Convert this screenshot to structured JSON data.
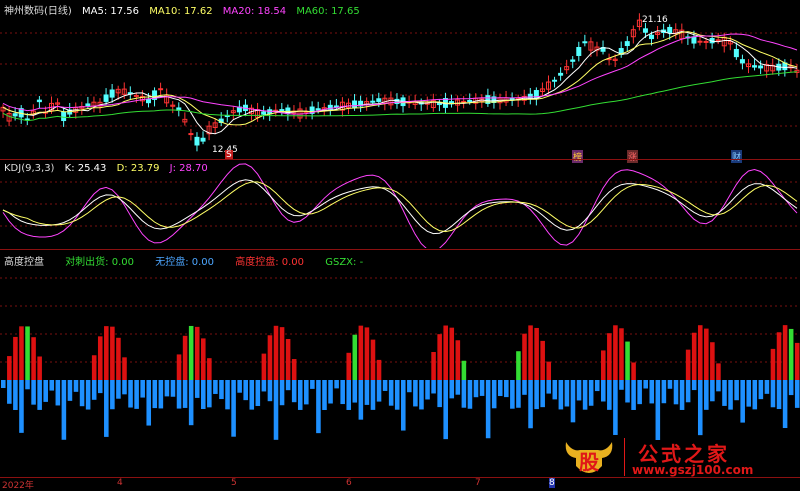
{
  "main": {
    "stock_title": "神州数码(日线)",
    "ma5": {
      "label": "MA5: 17.56",
      "color": "#ffffff"
    },
    "ma10": {
      "label": "MA10: 17.62",
      "color": "#ffff66"
    },
    "ma20": {
      "label": "MA20: 18.54",
      "color": "#ff44ff"
    },
    "ma60": {
      "label": "MA60: 17.65",
      "color": "#33dd33"
    },
    "high_label": "21.16",
    "low_label": "12.45",
    "badges": [
      "S",
      "榜",
      "涨",
      "财"
    ]
  },
  "kdj": {
    "title": "KDJ(9,3,3)",
    "k": {
      "label": "K: 25.43",
      "color": "#ffffff"
    },
    "d": {
      "label": "D: 23.79",
      "color": "#ffff66"
    },
    "j": {
      "label": "J: 28.70",
      "color": "#ff44ff"
    }
  },
  "control": {
    "title": "高度控盘",
    "out": {
      "label": "对刺出货: 0.00",
      "color": "#33dd33"
    },
    "none": {
      "label": "无控盘: 0.00",
      "color": "#4da6ff"
    },
    "high": {
      "label": "高度控盘: 0.00",
      "color": "#ff3333"
    },
    "gszx": {
      "label": "GSZX: -",
      "color": "#33dd33"
    }
  },
  "xaxis": {
    "labels": [
      "2022年",
      "4",
      "5",
      "6",
      "7",
      "8"
    ]
  },
  "watermark": {
    "title": "公式之家",
    "url": "www.gszj100.com",
    "logo_char": "股"
  },
  "chart_data": [
    {
      "type": "line",
      "title": "神州数码(日线)",
      "series": [
        {
          "name": "MA5",
          "value": 17.56
        },
        {
          "name": "MA10",
          "value": 17.62
        },
        {
          "name": "MA20",
          "value": 18.54
        },
        {
          "name": "MA60",
          "value": 17.65
        }
      ],
      "annotations": [
        "21.16",
        "12.45"
      ]
    },
    {
      "type": "line",
      "title": "KDJ(9,3,3)",
      "series": [
        {
          "name": "K",
          "value": 25.43
        },
        {
          "name": "D",
          "value": 23.79
        },
        {
          "name": "J",
          "value": 28.7
        }
      ]
    },
    {
      "type": "bar",
      "title": "高度控盘",
      "series": [
        {
          "name": "对刺出货",
          "value": 0.0
        },
        {
          "name": "无控盘",
          "value": 0.0
        },
        {
          "name": "高度控盘",
          "value": 0.0
        },
        {
          "name": "GSZX",
          "value": "-"
        }
      ]
    }
  ]
}
